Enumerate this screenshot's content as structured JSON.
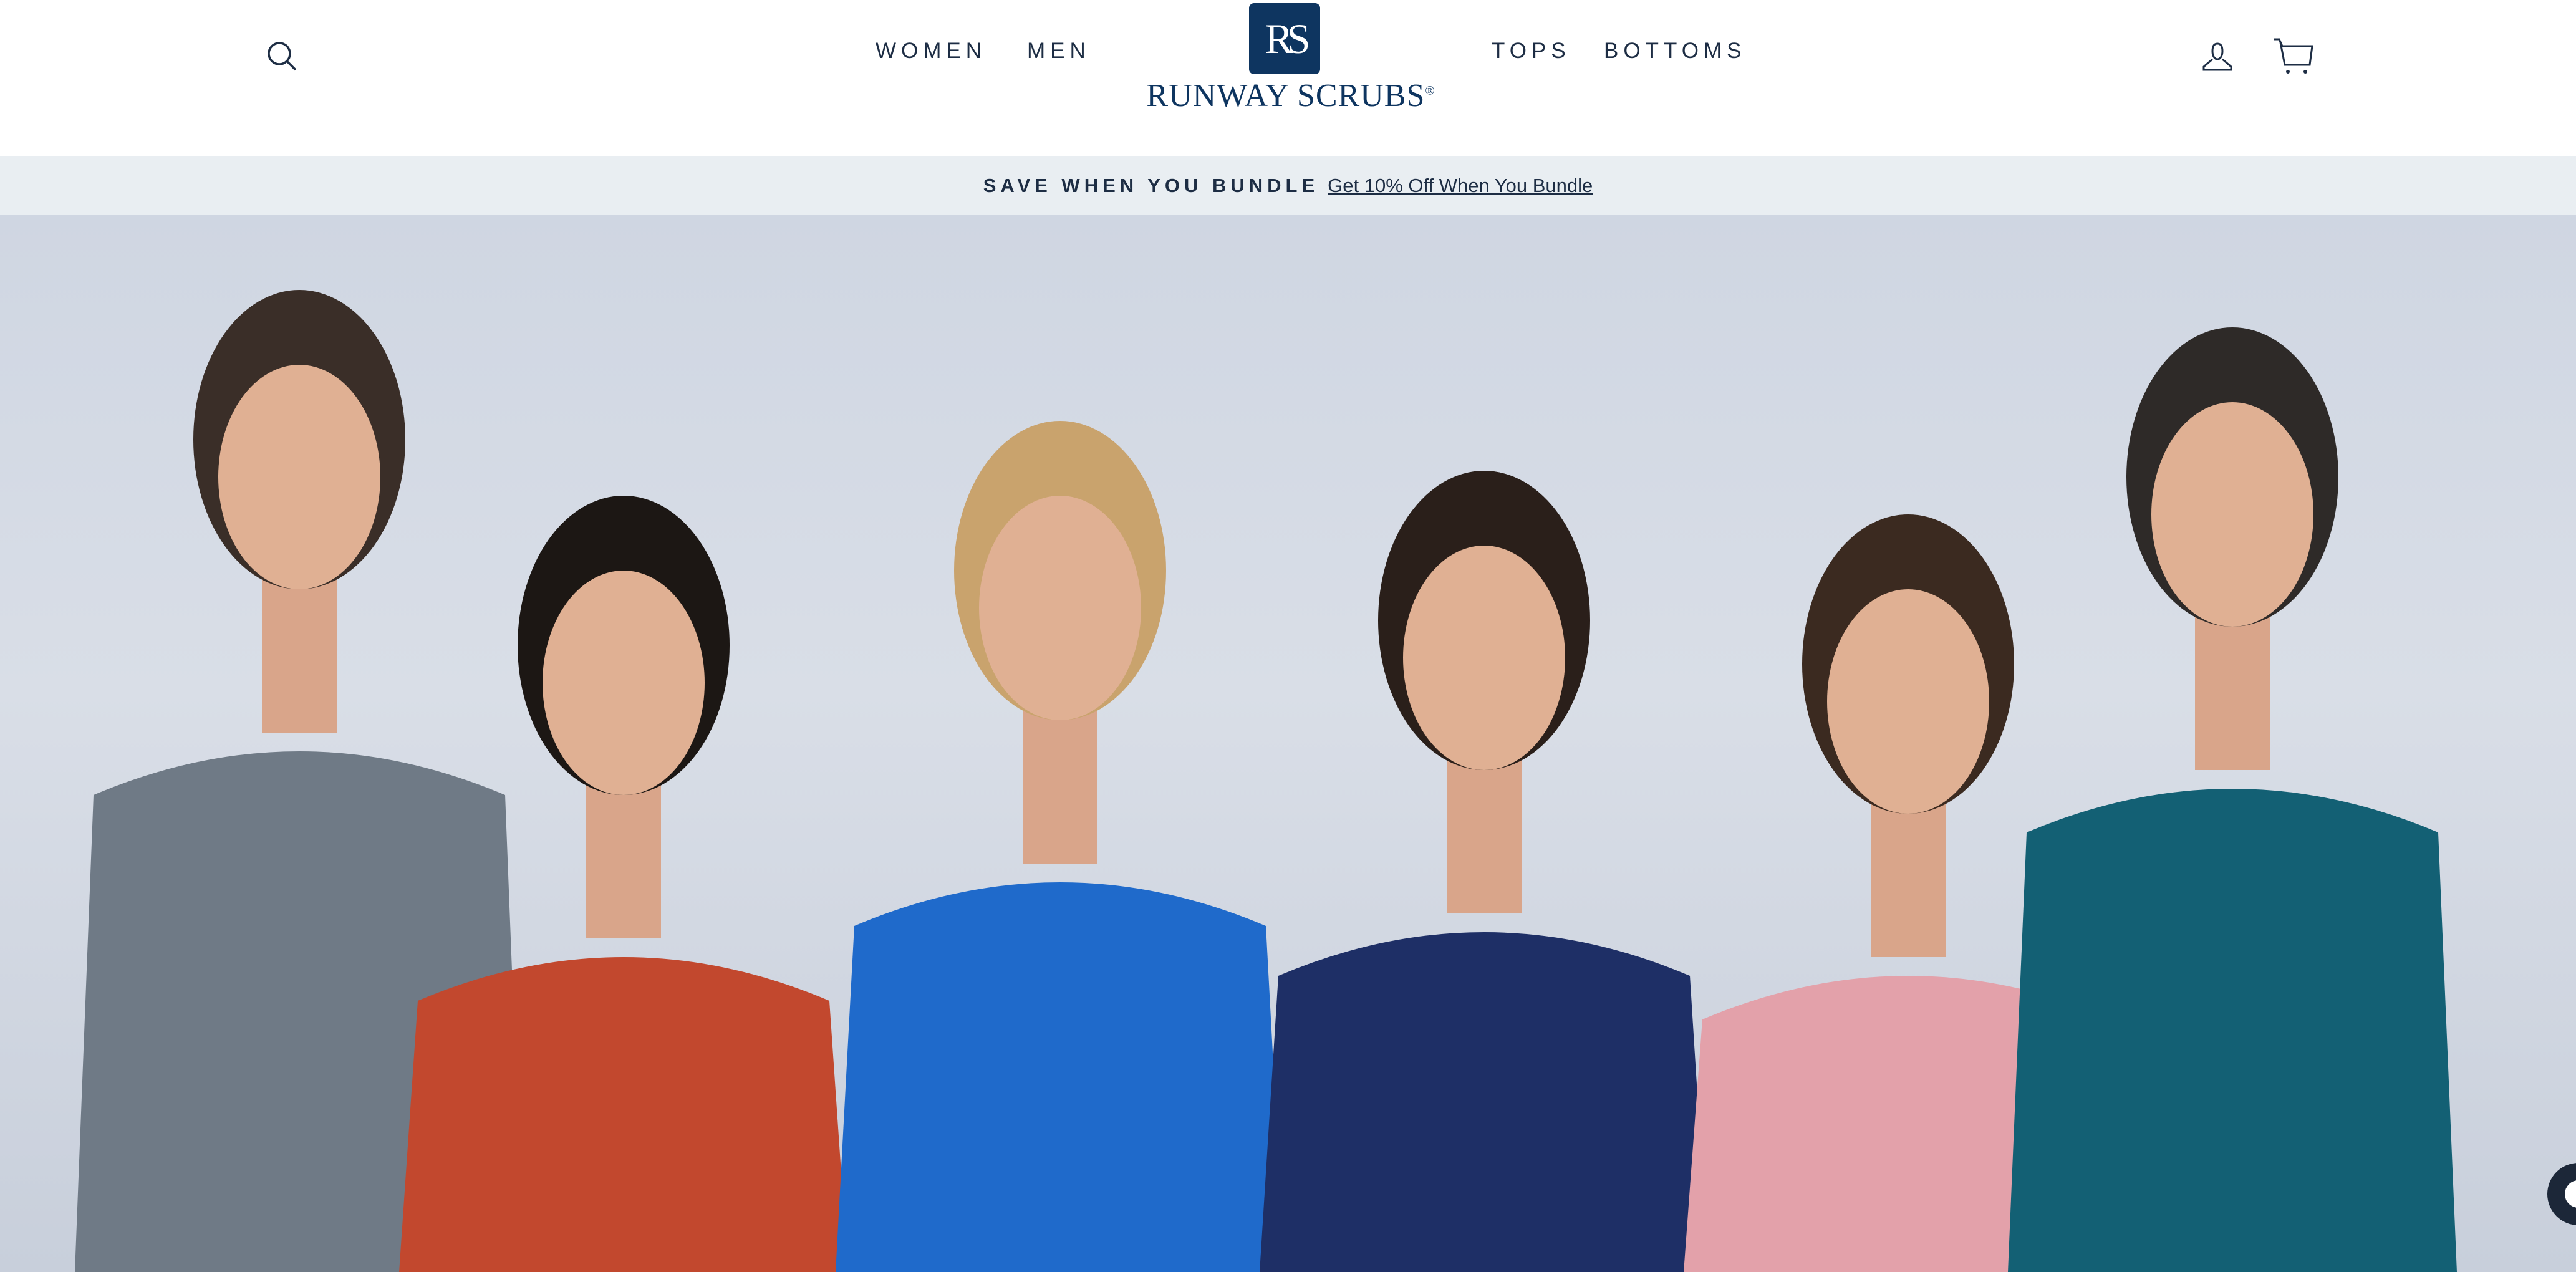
{
  "header": {
    "search_icon": "search-icon",
    "nav_left": [
      {
        "label": "WOMEN"
      },
      {
        "label": "MEN"
      }
    ],
    "nav_right": [
      {
        "label": "TOPS"
      },
      {
        "label": "BOTTOMS"
      }
    ],
    "logo": {
      "monogram": "RS",
      "name": "RUNWAY SCRUBS",
      "registered": "®"
    },
    "account_icon": "user-icon",
    "cart_icon": "cart-icon"
  },
  "banner": {
    "title": "SAVE WHEN YOU BUNDLE",
    "link": "Get 10% Off When You Bundle"
  },
  "hero": {
    "image": "Six models wearing scrubs",
    "scrub_colors": [
      "#6f7a86",
      "#c2482e",
      "#1f6acb",
      "#1e2f66",
      "#e3a1aa",
      "#136074"
    ]
  },
  "chat_icon": "chat-icon"
}
